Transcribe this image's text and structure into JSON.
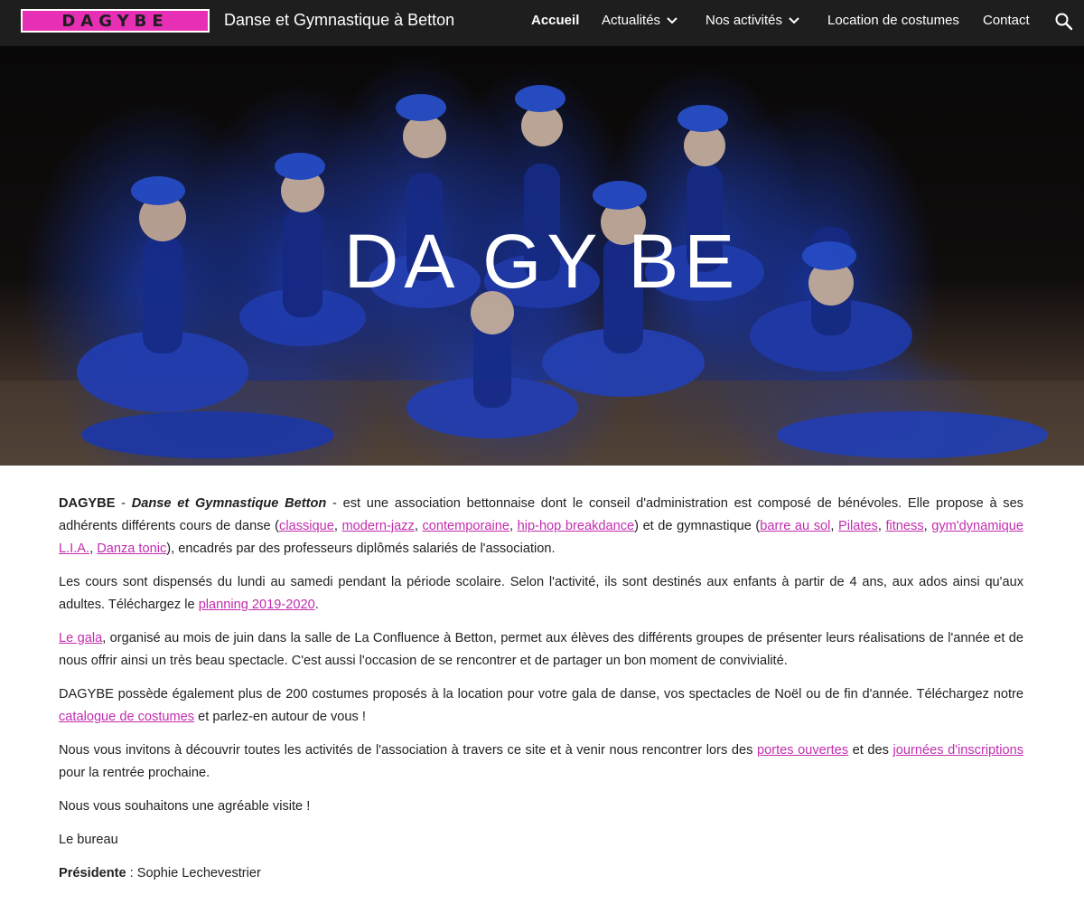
{
  "header": {
    "logo_text": "DAGYBE",
    "site_title": "Danse et Gymnastique à Betton",
    "nav": [
      {
        "label": "Accueil"
      },
      {
        "label": "Actualités"
      },
      {
        "label": "Nos activités"
      },
      {
        "label": "Location de costumes"
      },
      {
        "label": "Contact"
      }
    ],
    "search_icon": "search-icon"
  },
  "hero": {
    "title": "DA GY BE"
  },
  "content": {
    "p1": {
      "brand": "DAGYBE",
      "sep": " - ",
      "subtitle": "Danse et Gymnastique Betton",
      "text1": " - est une association bettonnaise dont le conseil d'administration est composé de bénévoles. Elle propose à ses adhérents différents cours de danse (",
      "dance_links": [
        "classique",
        "modern-jazz",
        "contemporaine",
        "hip-hop breakdance"
      ],
      "text2": ") et de gymnastique (",
      "gym_links": [
        "barre au sol",
        "Pilates",
        "fitness",
        "gym'dynamique L.I.A.",
        "Danza tonic"
      ],
      "text3": "), encadrés par des professeurs diplômés salariés de l'association."
    },
    "p2": {
      "text1": "Les cours sont dispensés du lundi au samedi pendant la période scolaire. Selon l'activité, ils sont destinés aux enfants à partir de 4 ans, aux ados ainsi qu'aux adultes. Téléchargez le ",
      "link": "planning 2019-2020",
      "text2": "."
    },
    "p3": {
      "link": "Le gala",
      "text": ", organisé au mois de juin dans la salle de La Confluence à Betton, permet aux élèves des différents groupes de présenter leurs réalisations de l'année et de nous offrir ainsi un très beau spectacle. C'est aussi l'occasion de se rencontrer et de partager un bon moment de convivialité."
    },
    "p4": {
      "text1": "DAGYBE possède également plus de 200 costumes proposés à la location pour votre gala de danse, vos spectacles de Noël ou de fin d'année. Téléchargez notre ",
      "link": "catalogue de costumes",
      "text2": " et parlez-en autour de vous !"
    },
    "p5": {
      "text1": "Nous vous invitons à découvrir toutes les activités de l'association à travers ce site et à venir nous rencontrer lors des ",
      "link1": "portes ouvertes",
      "text2": " et des ",
      "link2": "journées d'inscriptions",
      "text3": " pour la rentrée prochaine."
    },
    "p6": "Nous vous souhaitons une agréable visite !",
    "p7": "Le bureau",
    "p8": {
      "role": "Présidente",
      "text": " : Sophie Lechevestrier"
    }
  },
  "colors": {
    "topbar": "#1e1e1e",
    "logo_bg": "#e62fb4",
    "link": "#c32daf",
    "text": "#212121"
  }
}
